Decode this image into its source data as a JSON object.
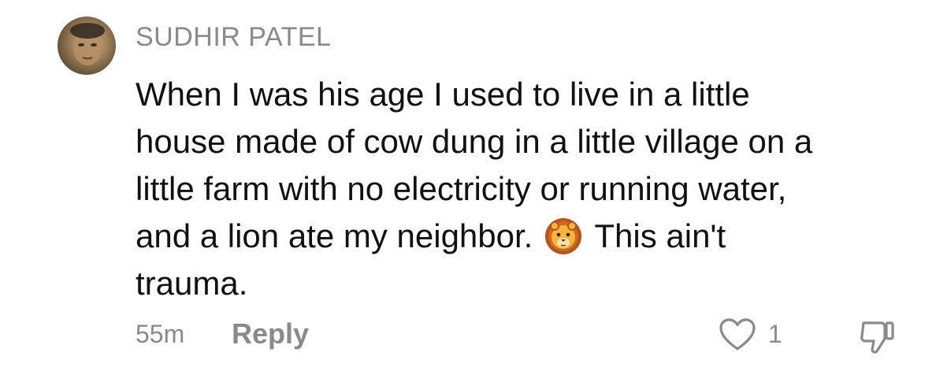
{
  "comment": {
    "username": "SUDHIR PATEL",
    "lines": [
      "When I was his age I used to live in a little",
      "house made of cow dung in a little village on a",
      "little farm with no electricity or running water,",
      "and a lion ate my neighbor.",
      "This ain't",
      "trauma."
    ],
    "emoji": "lion-face-emoji",
    "timestamp": "55m",
    "reply_label": "Reply",
    "like_count": "1"
  },
  "icons": {
    "avatar": "user-avatar",
    "like": "heart-outline-icon",
    "dislike": "thumbs-down-outline-icon"
  },
  "colors": {
    "text": "#111111",
    "muted": "#8a8a8a",
    "background": "#ffffff"
  }
}
